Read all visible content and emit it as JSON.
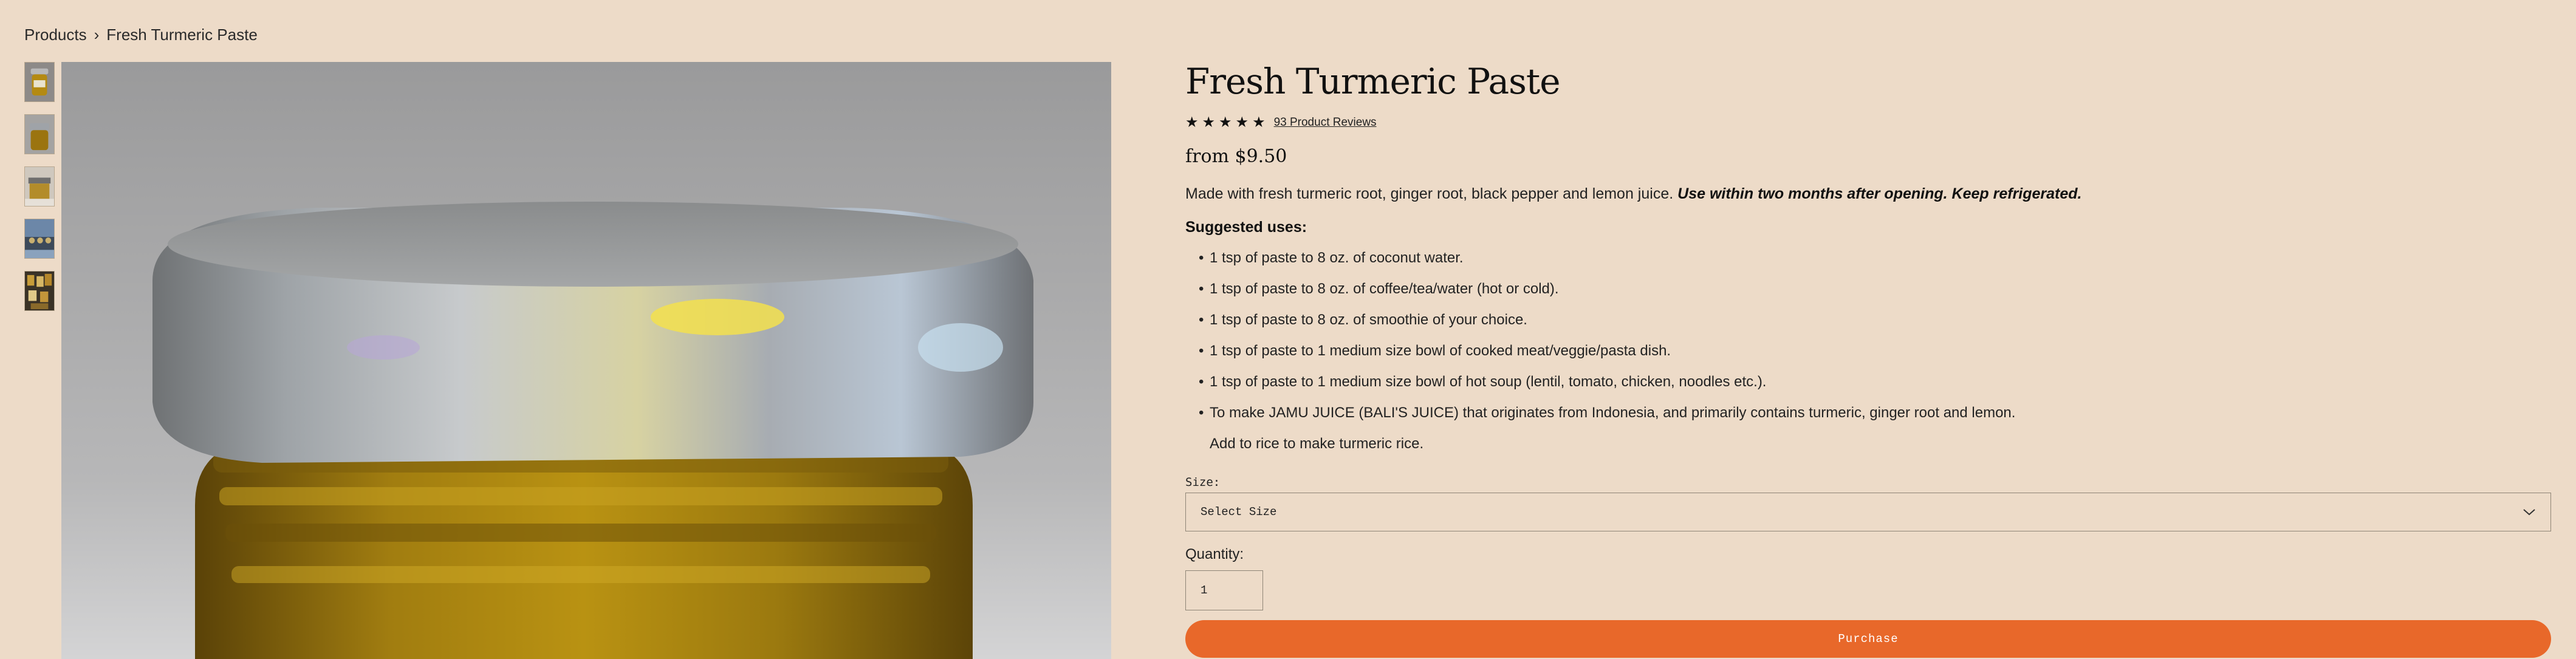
{
  "breadcrumb": {
    "parent": "Products",
    "separator": "›",
    "current": "Fresh Turmeric Paste"
  },
  "product": {
    "title": "Fresh Turmeric Paste",
    "rating_stars": 5,
    "reviews_label": "93 Product Reviews",
    "price": "from $9.50",
    "description_plain": "Made with fresh turmeric root, ginger root, black pepper and lemon juice.",
    "description_emphasis": "Use within two months after opening. Keep refrigerated.",
    "suggested_heading": "Suggested uses:",
    "uses": [
      "1 tsp of paste to 8 oz. of coconut water.",
      "1 tsp of paste to 8 oz. of coffee/tea/water (hot or cold).",
      "1 tsp of paste to 8 oz. of smoothie of your choice.",
      "1 tsp of paste to 1 medium size bowl of cooked meat/veggie/pasta dish.",
      "1 tsp of paste to 1 medium size bowl of hot soup (lentil, tomato, chicken, noodles etc.).",
      "To make JAMU JUICE (BALI'S JUICE) that originates from Indonesia, and primarily contains turmeric, ginger root and lemon."
    ],
    "uses_extra": "Add to rice to make turmeric rice."
  },
  "form": {
    "size_label": "Size:",
    "size_selected": "Select Size",
    "quantity_label": "Quantity:",
    "quantity_value": "1",
    "purchase_label": "Purchase"
  },
  "colors": {
    "background": "#eddbc8",
    "accent": "#e8682a"
  },
  "icons": {
    "star": "star-icon",
    "chevron": "chevron-down-icon"
  }
}
